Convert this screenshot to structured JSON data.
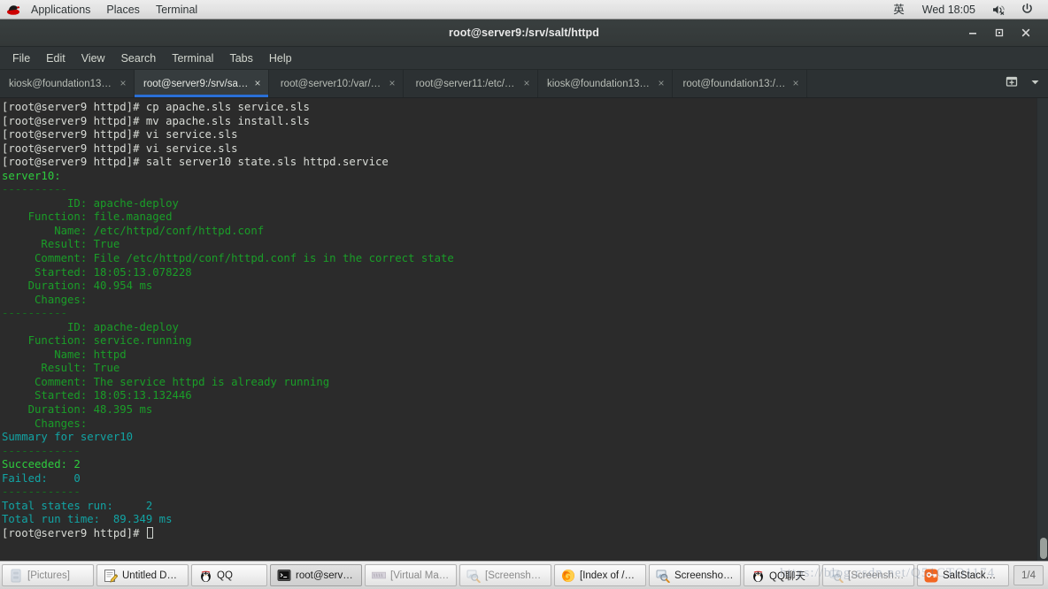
{
  "desktop": {
    "panel": {
      "logo_icon": "redhat-icon",
      "menus": [
        "Applications",
        "Places",
        "Terminal"
      ],
      "ime_indicator": "英",
      "clock": "Wed 18:05",
      "volume_icon": "volume-muted-icon",
      "power_icon": "power-icon"
    },
    "taskbar": {
      "buttons": [
        {
          "label": "[Pictures]",
          "icon": "file-manager-icon",
          "state": "minimized"
        },
        {
          "label": "Untitled D…",
          "icon": "text-editor-icon",
          "state": "normal"
        },
        {
          "label": "QQ",
          "icon": "qq-penguin-icon",
          "state": "normal"
        },
        {
          "label": "root@serv…",
          "icon": "terminal-icon",
          "state": "active"
        },
        {
          "label": "[Virtual Ma…]",
          "icon": "virt-manager-icon",
          "state": "minimized"
        },
        {
          "label": "[Screensho…]",
          "icon": "screenshot-icon",
          "state": "minimized"
        },
        {
          "label": "[Index of /…",
          "icon": "firefox-icon",
          "state": "normal"
        },
        {
          "label": "Screensho…",
          "icon": "screenshot-icon",
          "state": "normal"
        },
        {
          "label": "QQ聊天",
          "icon": "qq-penguin-icon",
          "state": "normal"
        },
        {
          "label": "[Screensho…]",
          "icon": "screenshot-icon",
          "state": "minimized"
        },
        {
          "label": "SaltStack…",
          "icon": "saltstack-icon",
          "state": "normal"
        }
      ],
      "workspace": "1/4",
      "watermark": "https://blog.csdn.net/Q51CTO1174"
    }
  },
  "window": {
    "title": "root@server9:/srv/salt/httpd",
    "controls": {
      "minimize": "–",
      "maximize": "□",
      "close": "✕"
    },
    "menubar": [
      "File",
      "Edit",
      "View",
      "Search",
      "Terminal",
      "Tabs",
      "Help"
    ],
    "tabs": [
      {
        "label": "kiosk@foundation13:…",
        "active": false
      },
      {
        "label": "root@server9:/srv/sal…",
        "active": true
      },
      {
        "label": "root@server10:/var/…",
        "active": false
      },
      {
        "label": "root@server11:/etc/…",
        "active": false
      },
      {
        "label": "kiosk@foundation13:…",
        "active": false
      },
      {
        "label": "root@foundation13:/…",
        "active": false
      }
    ],
    "tab_close_glyph": "×",
    "new_tab_icon": "new-tab-icon",
    "tab_menu_icon": "chevron-down-icon"
  },
  "terminal": {
    "prompt": "[root@server9 httpd]# ",
    "lines": [
      {
        "segments": [
          {
            "t": "[root@server9 httpd]# ",
            "c": "white"
          },
          {
            "t": "cp apache.sls service.sls",
            "c": "white"
          }
        ]
      },
      {
        "segments": [
          {
            "t": "[root@server9 httpd]# ",
            "c": "white"
          },
          {
            "t": "mv apache.sls install.sls",
            "c": "white"
          }
        ]
      },
      {
        "segments": [
          {
            "t": "[root@server9 httpd]# ",
            "c": "white"
          },
          {
            "t": "vi service.sls",
            "c": "white"
          }
        ]
      },
      {
        "segments": [
          {
            "t": "[root@server9 httpd]# ",
            "c": "white"
          },
          {
            "t": "vi service.sls",
            "c": "white"
          }
        ]
      },
      {
        "segments": [
          {
            "t": "[root@server9 httpd]# ",
            "c": "white"
          },
          {
            "t": "salt server10 state.sls httpd.service",
            "c": "white"
          }
        ]
      },
      {
        "segments": [
          {
            "t": "server10:",
            "c": "bgreen"
          }
        ]
      },
      {
        "segments": [
          {
            "t": "----------",
            "c": "dim"
          }
        ]
      },
      {
        "segments": [
          {
            "t": "          ID: apache-deploy",
            "c": "green"
          }
        ]
      },
      {
        "segments": [
          {
            "t": "    Function: file.managed",
            "c": "green"
          }
        ]
      },
      {
        "segments": [
          {
            "t": "        Name: /etc/httpd/conf/httpd.conf",
            "c": "green"
          }
        ]
      },
      {
        "segments": [
          {
            "t": "      Result: True",
            "c": "green"
          }
        ]
      },
      {
        "segments": [
          {
            "t": "     Comment: File /etc/httpd/conf/httpd.conf is in the correct state",
            "c": "green"
          }
        ]
      },
      {
        "segments": [
          {
            "t": "     Started: 18:05:13.078228",
            "c": "green"
          }
        ]
      },
      {
        "segments": [
          {
            "t": "    Duration: 40.954 ms",
            "c": "green"
          }
        ]
      },
      {
        "segments": [
          {
            "t": "     Changes:   ",
            "c": "green"
          }
        ]
      },
      {
        "segments": [
          {
            "t": "----------",
            "c": "dim"
          }
        ]
      },
      {
        "segments": [
          {
            "t": "          ID: apache-deploy",
            "c": "green"
          }
        ]
      },
      {
        "segments": [
          {
            "t": "    Function: service.running",
            "c": "green"
          }
        ]
      },
      {
        "segments": [
          {
            "t": "        Name: httpd",
            "c": "green"
          }
        ]
      },
      {
        "segments": [
          {
            "t": "      Result: True",
            "c": "green"
          }
        ]
      },
      {
        "segments": [
          {
            "t": "     Comment: The service httpd is already running",
            "c": "green"
          }
        ]
      },
      {
        "segments": [
          {
            "t": "     Started: 18:05:13.132446",
            "c": "green"
          }
        ]
      },
      {
        "segments": [
          {
            "t": "    Duration: 48.395 ms",
            "c": "green"
          }
        ]
      },
      {
        "segments": [
          {
            "t": "     Changes:   ",
            "c": "green"
          }
        ]
      },
      {
        "segments": [
          {
            "t": "",
            "c": "green"
          }
        ]
      },
      {
        "segments": [
          {
            "t": "Summary for server10",
            "c": "cyan"
          }
        ]
      },
      {
        "segments": [
          {
            "t": "------------",
            "c": "dim"
          }
        ]
      },
      {
        "segments": [
          {
            "t": "Succeeded: 2",
            "c": "bgreen"
          }
        ]
      },
      {
        "segments": [
          {
            "t": "Failed:    0",
            "c": "cyan"
          }
        ]
      },
      {
        "segments": [
          {
            "t": "------------",
            "c": "dim"
          }
        ]
      },
      {
        "segments": [
          {
            "t": "Total states run:     2",
            "c": "cyan"
          }
        ]
      },
      {
        "segments": [
          {
            "t": "Total run time:  89.349 ms",
            "c": "cyan"
          }
        ]
      }
    ],
    "last_line_prompt": "[root@server9 httpd]# ",
    "cursor": "block-cursor"
  }
}
